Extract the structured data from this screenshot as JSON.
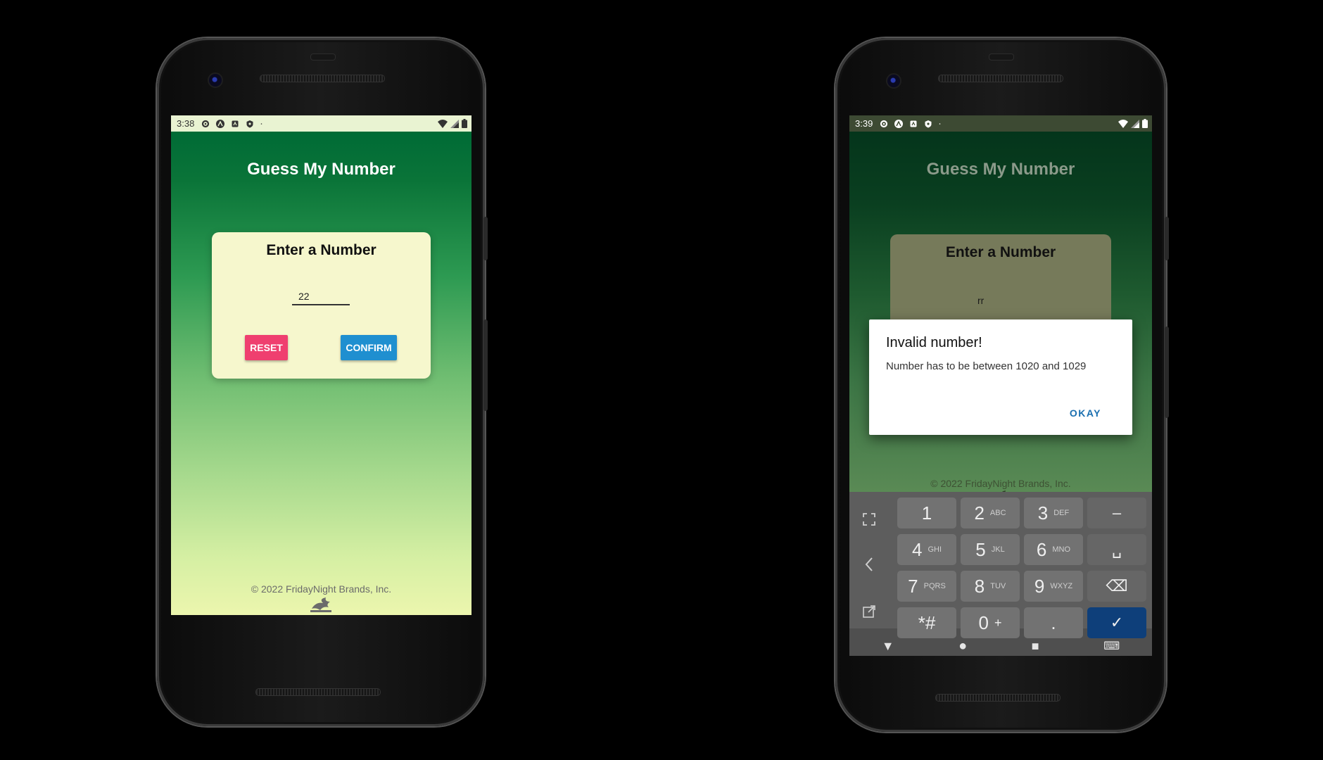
{
  "left_phone": {
    "status": {
      "time": "3:38"
    },
    "app": {
      "title": "Guess My Number",
      "card_title": "Enter a Number",
      "input_value": "22",
      "reset_label": "RESET",
      "confirm_label": "CONFIRM",
      "footer": "©  2022 FridayNight Brands, Inc."
    },
    "nav": {
      "back": "◀",
      "home": "●",
      "recents": "■"
    }
  },
  "right_phone": {
    "status": {
      "time": "3:39"
    },
    "app": {
      "title": "Guess My Number",
      "card_title": "Enter a Number",
      "input_value": "rr",
      "footer": "©  2022 FridayNight Brands, Inc."
    },
    "dialog": {
      "title": "Invalid number!",
      "message": "Number has to be between 1020 and 1029",
      "ok_label": "OKAY"
    },
    "keyboard": {
      "keys": [
        {
          "main": "1",
          "sub": ""
        },
        {
          "main": "2",
          "sub": "ABC"
        },
        {
          "main": "3",
          "sub": "DEF"
        },
        {
          "main": "–",
          "sub": ""
        },
        {
          "main": "4",
          "sub": "GHI"
        },
        {
          "main": "5",
          "sub": "JKL"
        },
        {
          "main": "6",
          "sub": "MNO"
        },
        {
          "main": "␣",
          "sub": ""
        },
        {
          "main": "7",
          "sub": "PQRS"
        },
        {
          "main": "8",
          "sub": "TUV"
        },
        {
          "main": "9",
          "sub": "WXYZ"
        },
        {
          "main": "⌫",
          "sub": ""
        },
        {
          "main": "*#",
          "sub": ""
        },
        {
          "main": "0",
          "sub": "+"
        },
        {
          "main": ".",
          "sub": ""
        },
        {
          "main": "✓",
          "sub": ""
        }
      ]
    },
    "nav": {
      "back": "▼",
      "home": "●",
      "recents": "■",
      "keyboard": "⌨"
    }
  },
  "colors": {
    "reset": "#ef3f6f",
    "confirm": "#1f8fd0",
    "card": "#f6f7cd",
    "okay": "#1a6fb0"
  }
}
